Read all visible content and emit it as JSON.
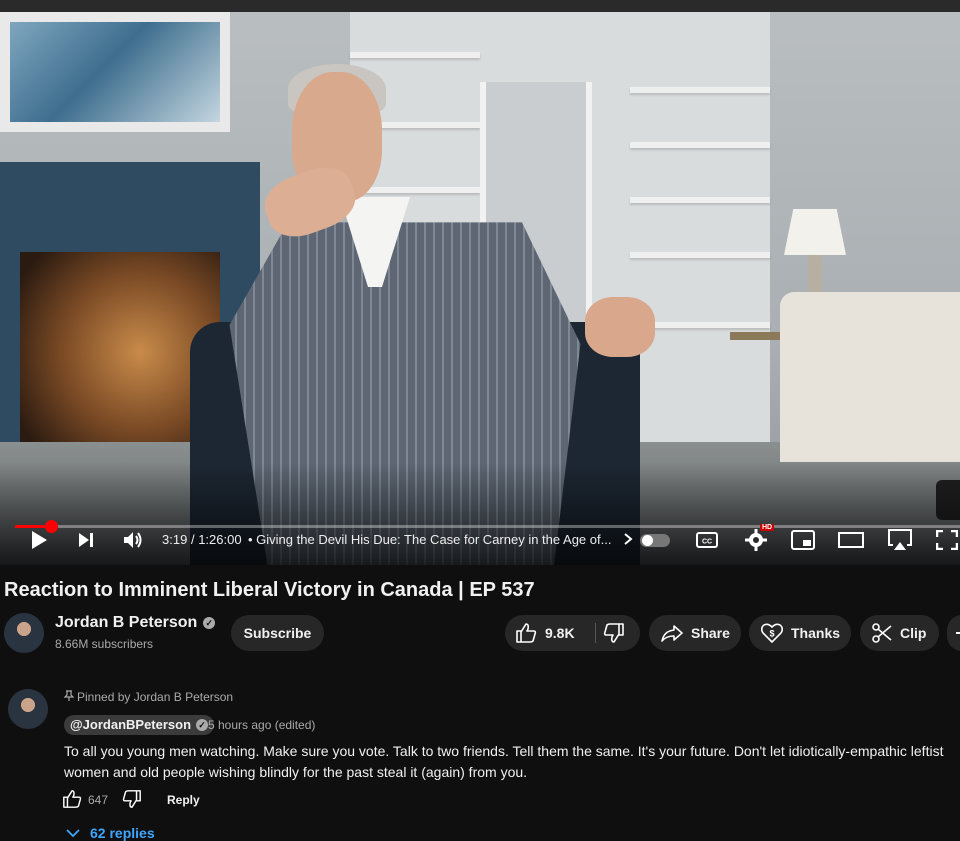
{
  "player": {
    "current_time": "3:19",
    "separator": "/",
    "duration": "1:26:00",
    "chapter_title": "Giving the Devil His Due: The Case for Carney in the Age of...",
    "progress_fraction": 0.0386,
    "quality_badge": "HD",
    "controls": [
      "play-icon",
      "next-icon",
      "volume-icon",
      "autoplay-toggle",
      "captions-icon",
      "settings-icon",
      "miniplayer-icon",
      "theater-icon",
      "airplay-icon",
      "fullscreen-icon"
    ]
  },
  "video": {
    "title": "Reaction to Imminent Liberal Victory in Canada | EP 537"
  },
  "channel": {
    "name": "Jordan B Peterson",
    "subscribers": "8.66M subscribers",
    "verified_mark": "✓"
  },
  "actions": {
    "subscribe": "Subscribe",
    "likes": "9.8K",
    "share": "Share",
    "thanks": "Thanks",
    "clip": "Clip"
  },
  "comment": {
    "pinned_label": "Pinned by Jordan B Peterson",
    "handle": "@JordanBPeterson",
    "time_ago": "5 hours ago (edited)",
    "text": "To all you young men watching. Make sure you vote. Talk to two friends. Tell them the same. It's your future. Don't let idiotically-empathic leftist women and old people wishing blindly for the past steal it (again) from you.",
    "like_count": "647",
    "reply_label": "Reply",
    "replies_label": "62 replies"
  },
  "colors": {
    "background": "#0f0f0f",
    "progress": "#ff0000",
    "link_blue": "#3ea6ff",
    "pill": "#272727"
  }
}
